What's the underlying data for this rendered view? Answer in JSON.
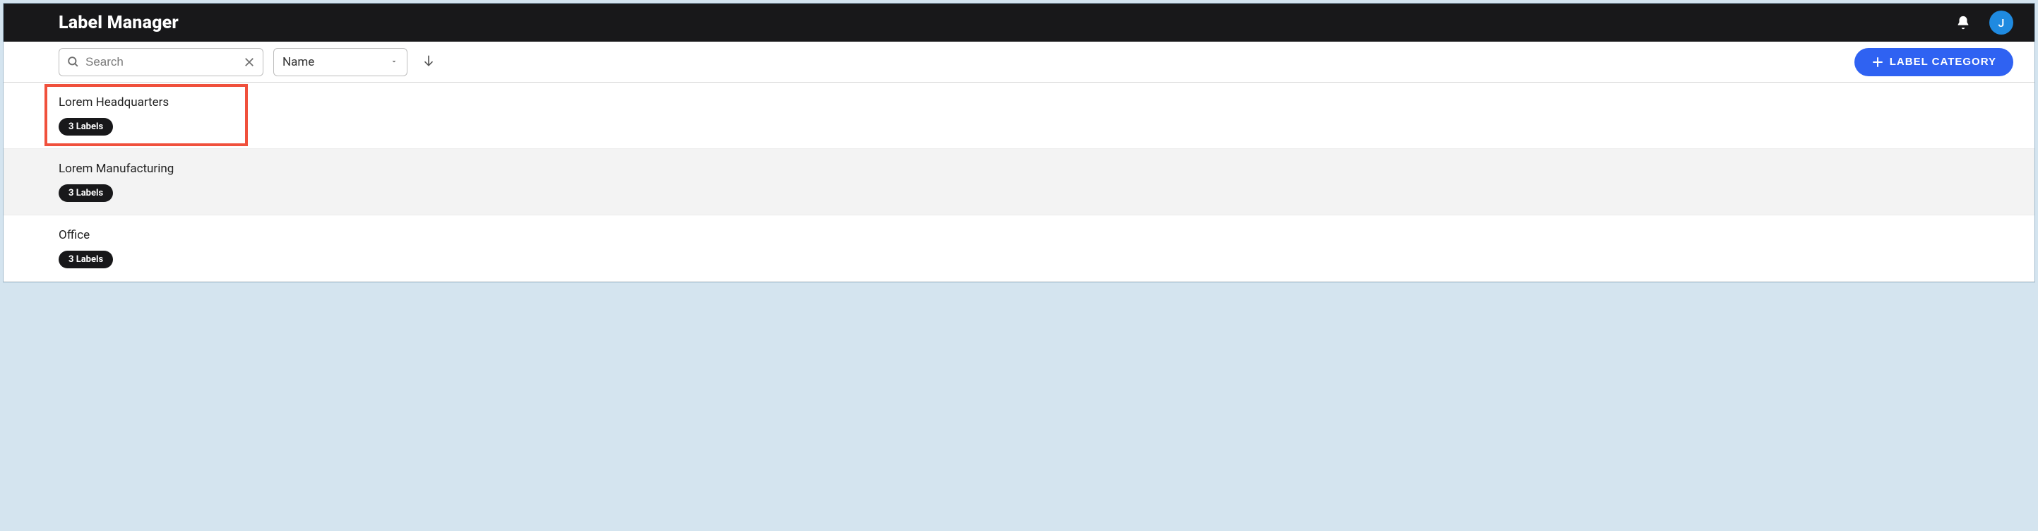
{
  "header": {
    "title": "Label Manager",
    "avatar_initial": "J"
  },
  "toolbar": {
    "search_placeholder": "Search",
    "sort_label": "Name",
    "add_button_label": "LABEL CATEGORY"
  },
  "rows": [
    {
      "name": "Lorem Headquarters",
      "badge": "3 Labels"
    },
    {
      "name": "Lorem Manufacturing",
      "badge": "3 Labels"
    },
    {
      "name": "Office",
      "badge": "3 Labels"
    }
  ],
  "highlight_index": 0
}
